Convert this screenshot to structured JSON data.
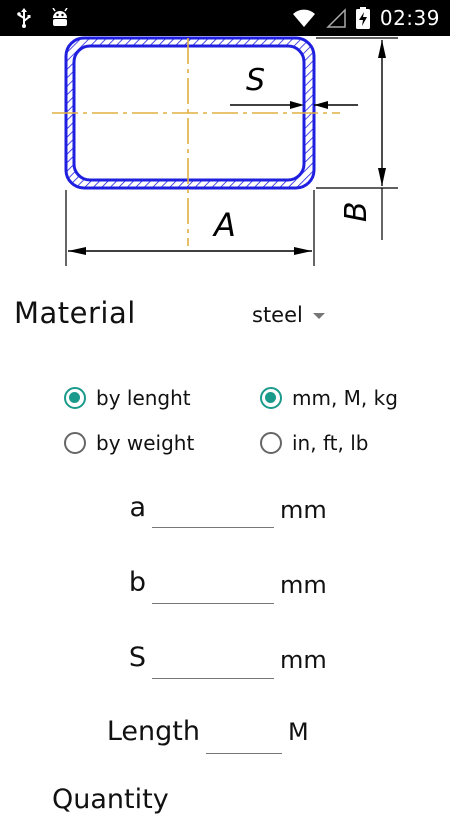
{
  "status_bar": {
    "time": "02:39",
    "left_icons": [
      "usb-icon",
      "android-debug-icon"
    ],
    "right_icons": [
      "wifi-icon",
      "signal-icon",
      "battery-charging-icon"
    ]
  },
  "drawing": {
    "labels": {
      "s": "S",
      "a": "A",
      "b": "B"
    },
    "colors": {
      "outline": "#1f1fe0",
      "hatch": "#1f1fe0",
      "centerline": "#e0b040",
      "dimension": "#000000"
    }
  },
  "material": {
    "label": "Material",
    "selected": "steel"
  },
  "calc_mode": {
    "options": [
      {
        "label": "by lenght",
        "checked": true
      },
      {
        "label": "by weight",
        "checked": false
      }
    ]
  },
  "units": {
    "options": [
      {
        "label": "mm, M, kg",
        "checked": true
      },
      {
        "label": "in, ft, lb",
        "checked": false
      }
    ]
  },
  "fields": {
    "a": {
      "label": "a",
      "value": "",
      "unit": "mm"
    },
    "b": {
      "label": "b",
      "value": "",
      "unit": "mm"
    },
    "s": {
      "label": "S",
      "value": "",
      "unit": "mm"
    },
    "length": {
      "label": "Length",
      "value": "",
      "unit": "M"
    }
  },
  "partial_label": "Quantity",
  "accent_color": "#1a9a8a"
}
